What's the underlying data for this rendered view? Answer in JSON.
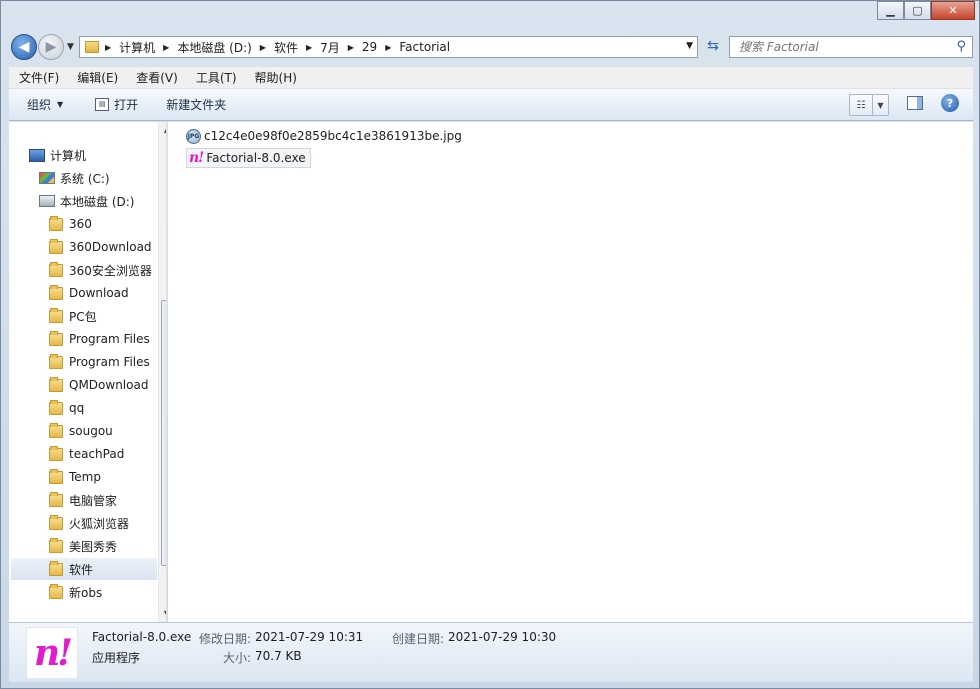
{
  "navigation": {
    "breadcrumbs": [
      "计算机",
      "本地磁盘 (D:)",
      "软件",
      "7月",
      "29",
      "Factorial"
    ],
    "search_placeholder": "搜索 Factorial"
  },
  "menubar": {
    "items": [
      "文件(F)",
      "编辑(E)",
      "查看(V)",
      "工具(T)",
      "帮助(H)"
    ]
  },
  "commandbar": {
    "organize_label": "组织",
    "open_label": "打开",
    "new_folder_label": "新建文件夹"
  },
  "tree": {
    "computer_label": "计算机",
    "drive_c_label": "系统 (C:)",
    "drive_d_label": "本地磁盘 (D:)",
    "folders": [
      "360",
      "360Download",
      "360安全浏览器",
      "Download",
      "PC包",
      "Program Files",
      "Program Files",
      "QMDownload",
      "qq",
      "sougou",
      "teachPad",
      "Temp",
      "电脑管家",
      "火狐浏览器",
      "美图秀秀",
      "软件",
      "新obs"
    ],
    "selected_folder": "软件"
  },
  "files": [
    {
      "name": "c12c4e0e98f0e2859bc4c1e3861913be.jpg",
      "icon": "jpg-file-icon"
    },
    {
      "name": "Factorial-8.0.exe",
      "icon": "factorial-app-icon"
    }
  ],
  "details": {
    "file_name": "Factorial-8.0.exe",
    "file_type": "应用程序",
    "modified_label": "修改日期:",
    "modified_value": "2021-07-29 10:31",
    "created_label": "创建日期:",
    "created_value": "2021-07-29 10:30",
    "size_label": "大小:",
    "size_value": "70.7 KB",
    "thumb_text": "n!"
  },
  "icons": {
    "exe_glyph": "n!",
    "jpg_glyph": "JPG"
  },
  "colors": {
    "accent_magenta": "#e01bd0",
    "selection_bg": "#d9e4f1"
  }
}
